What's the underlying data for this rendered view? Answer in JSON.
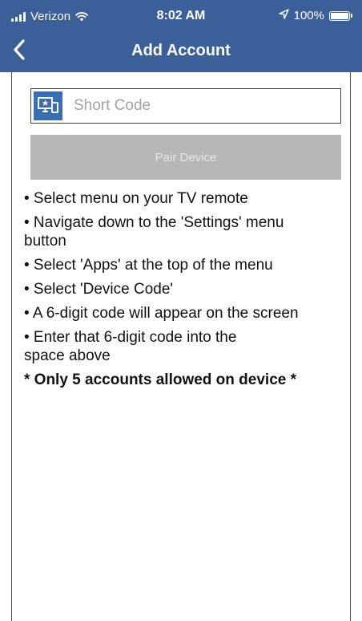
{
  "status_bar": {
    "carrier": "Verizon",
    "time": "8:02 AM",
    "battery": "100%"
  },
  "header": {
    "title": "Add Account",
    "back_icon": "chevron-left-icon"
  },
  "code_field": {
    "placeholder": "Short Code",
    "value": "",
    "icon": "device-code-icon"
  },
  "pair_button": {
    "label": "Pair Device"
  },
  "instructions": {
    "items": [
      "• Select menu on your TV remote",
      "• Navigate down to the 'Settings' menu button",
      "• Select 'Apps' at the top of the menu",
      "• Select 'Device Code'",
      "• A 6-digit code will appear on the screen",
      "• Enter that 6-digit code into the space above"
    ],
    "warning": "* Only 5 accounts allowed on device *"
  },
  "colors": {
    "header_bg": "#3b5f98",
    "icon_bg": "#3b6db4",
    "button_disabled_bg": "#b7b7b7"
  }
}
